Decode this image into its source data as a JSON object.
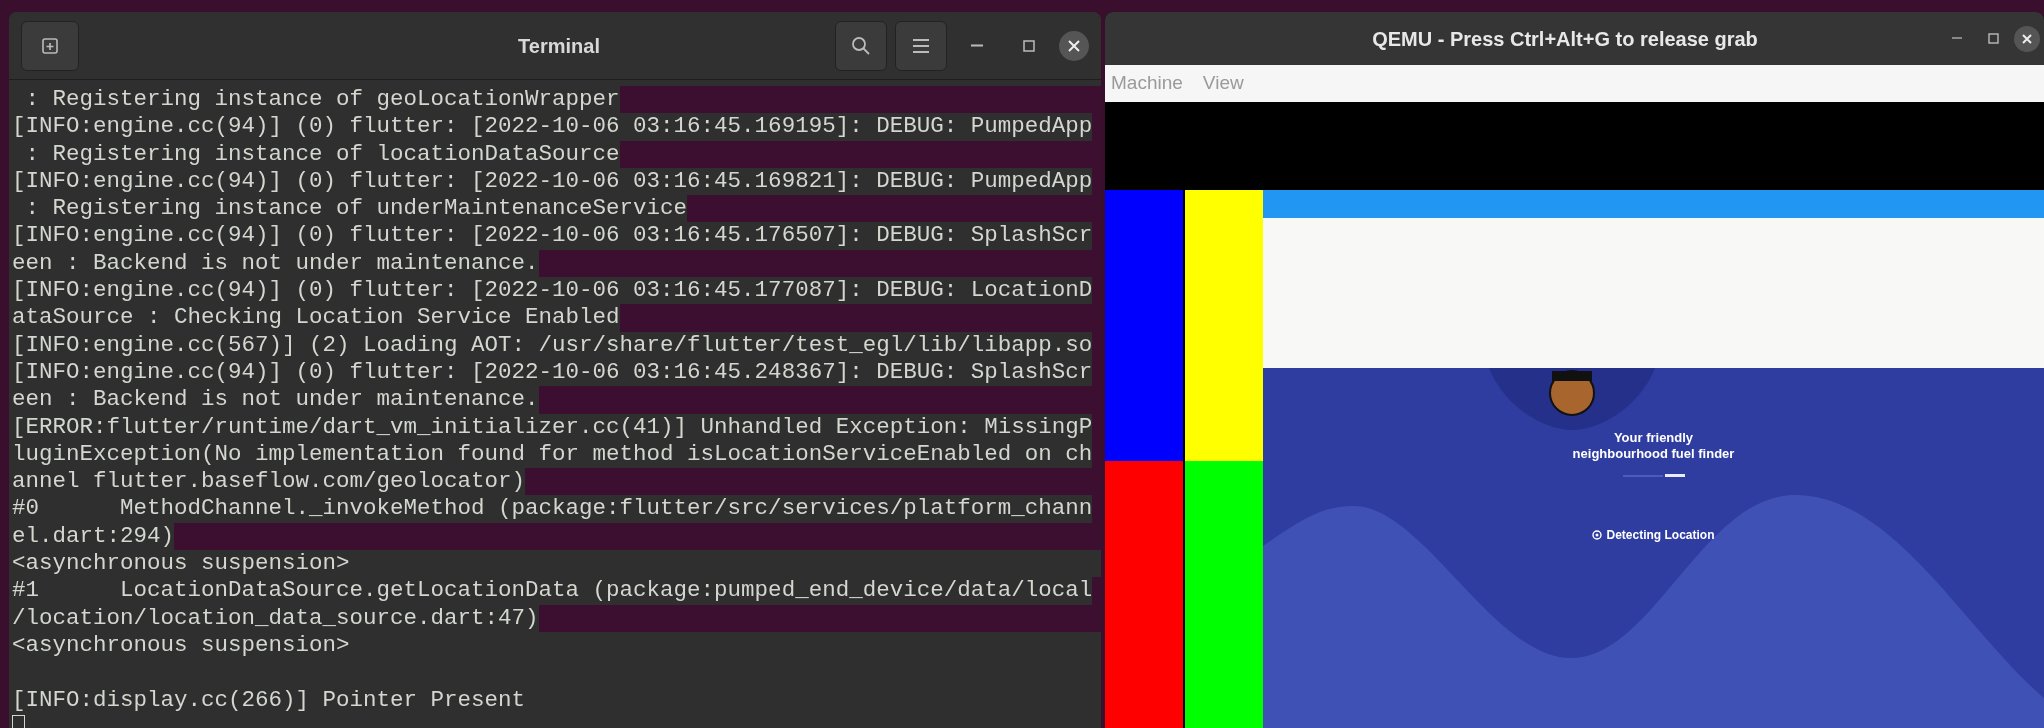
{
  "terminal": {
    "title": "Terminal",
    "lines": [
      {
        "text": " : Registering instance of geoLocationWrapper",
        "highlighted": true
      },
      {
        "text": "[INFO:engine.cc(94)] (0) flutter: [2022-10-06 03:16:45.169195]: DEBUG: PumpedApp",
        "highlighted": true
      },
      {
        "text": " : Registering instance of locationDataSource",
        "highlighted": true
      },
      {
        "text": "[INFO:engine.cc(94)] (0) flutter: [2022-10-06 03:16:45.169821]: DEBUG: PumpedApp",
        "highlighted": true
      },
      {
        "text": " : Registering instance of underMaintenanceService",
        "highlighted": true
      },
      {
        "text": "[INFO:engine.cc(94)] (0) flutter: [2022-10-06 03:16:45.176507]: DEBUG: SplashScr",
        "highlighted": true
      },
      {
        "text": "een : Backend is not under maintenance.",
        "highlighted": true
      },
      {
        "text": "[INFO:engine.cc(94)] (0) flutter: [2022-10-06 03:16:45.177087]: DEBUG: LocationD",
        "highlighted": true
      },
      {
        "text": "ataSource : Checking Location Service Enabled",
        "highlighted": true
      },
      {
        "text": "[INFO:engine.cc(567)] (2) Loading AOT: /usr/share/flutter/test_egl/lib/libapp.so",
        "highlighted": true
      },
      {
        "text": "[INFO:engine.cc(94)] (0) flutter: [2022-10-06 03:16:45.248367]: DEBUG: SplashScr",
        "highlighted": true
      },
      {
        "text": "een : Backend is not under maintenance.",
        "highlighted": true
      },
      {
        "text": "[ERROR:flutter/runtime/dart_vm_initializer.cc(41)] Unhandled Exception: MissingP",
        "highlighted": true
      },
      {
        "text": "luginException(No implementation found for method isLocationServiceEnabled on ch",
        "highlighted": true
      },
      {
        "text": "annel flutter.baseflow.com/geolocator)",
        "highlighted": true
      },
      {
        "text": "#0      MethodChannel._invokeMethod (package:flutter/src/services/platform_chann",
        "highlighted": true
      },
      {
        "text": "el.dart:294)",
        "highlighted": true
      },
      {
        "text": "<asynchronous suspension>",
        "highlighted": false
      },
      {
        "text": "#1      LocationDataSource.getLocationData (package:pumped_end_device/data/local",
        "highlighted": true
      },
      {
        "text": "/location/location_data_source.dart:47)",
        "highlighted": true
      },
      {
        "text": "<asynchronous suspension>",
        "highlighted": false
      },
      {
        "highlighted": false
      },
      {
        "text": "[INFO:display.cc(266)] Pointer Present",
        "highlighted": false
      }
    ]
  },
  "qemu": {
    "title": "QEMU - Press Ctrl+Alt+G to release grab",
    "menu": [
      "Machine",
      "View"
    ],
    "app": {
      "tagline": [
        "Your friendly",
        "neighbourhood fuel finder"
      ],
      "status": "Detecting Location"
    }
  }
}
